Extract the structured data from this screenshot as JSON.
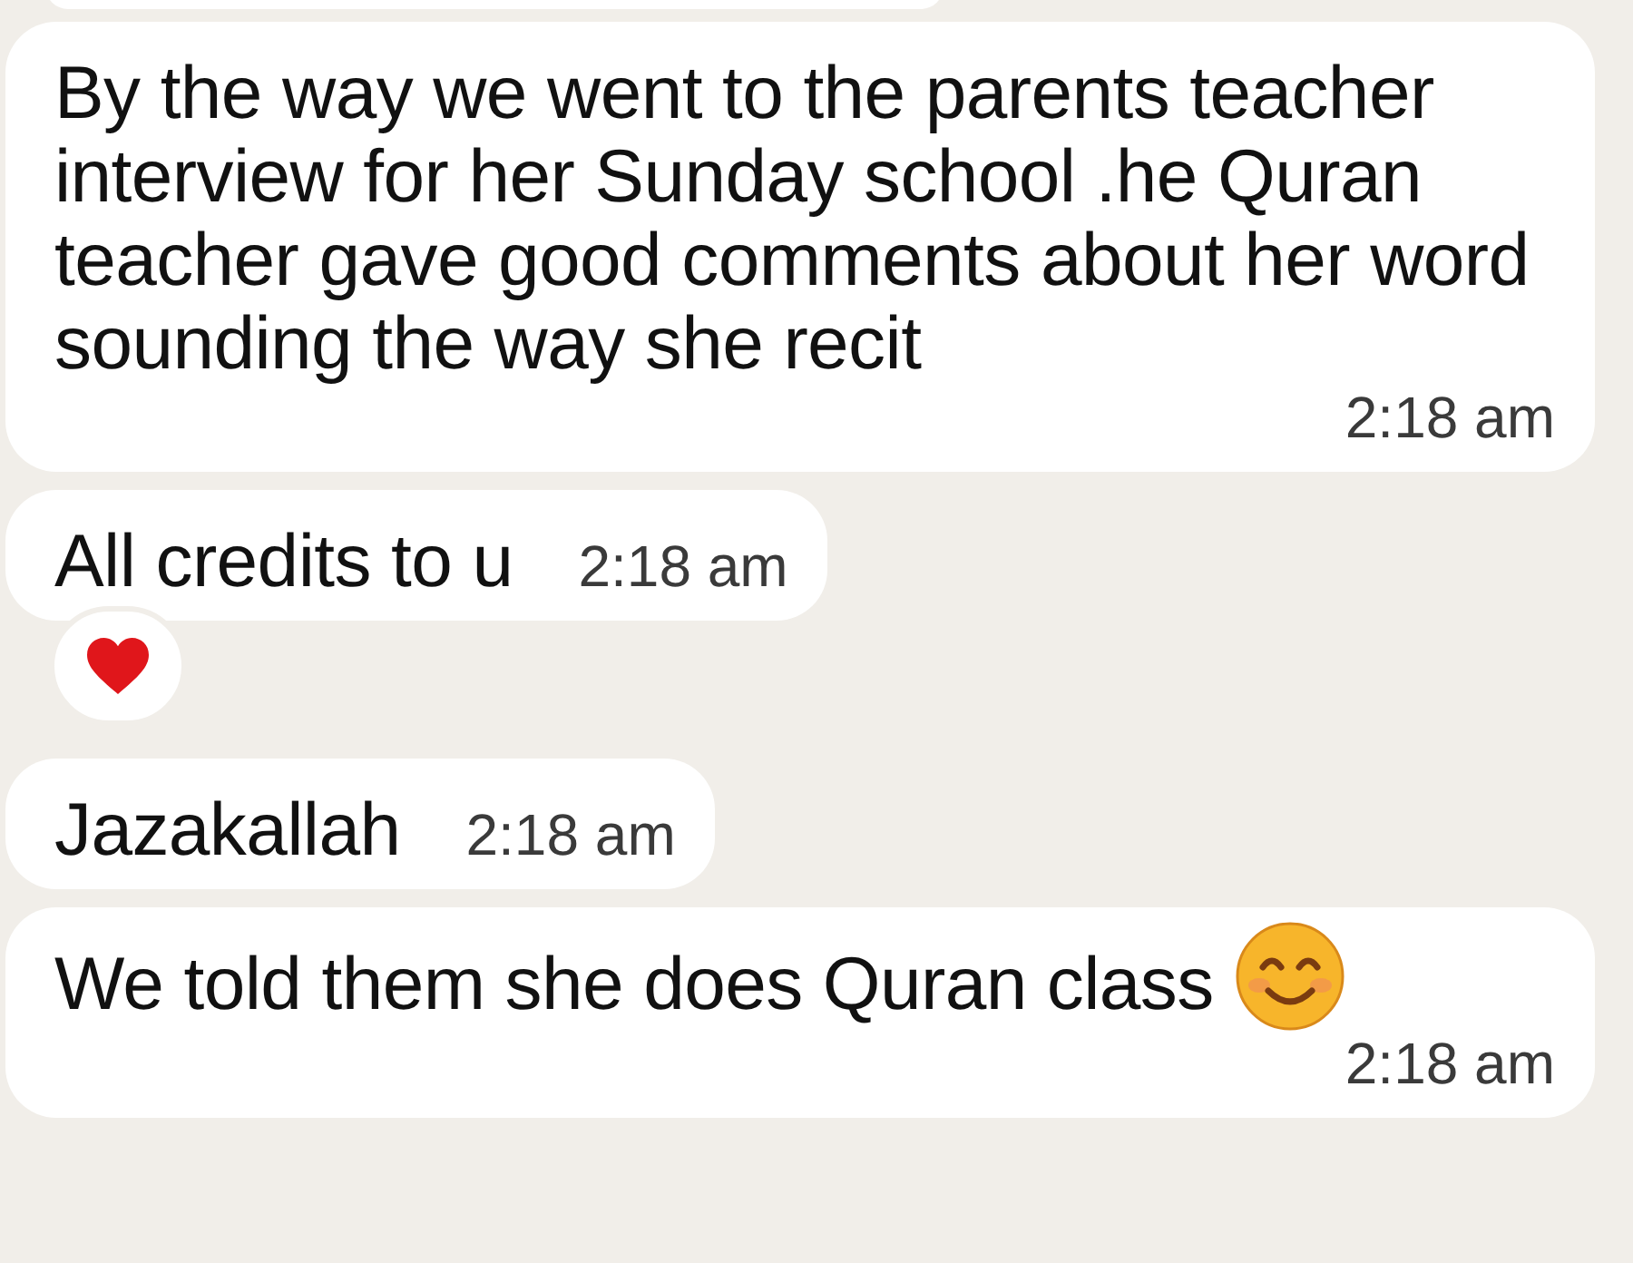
{
  "messages": [
    {
      "text": "By the way we went to the parents teacher interview for her Sunday school .he Quran teacher gave good comments about her word sounding the way she recit",
      "time": "2:18 am"
    },
    {
      "text": "All credits to u",
      "time": "2:18 am",
      "reaction": {
        "kind": "heart"
      }
    },
    {
      "text": "Jazakallah",
      "time": "2:18 am"
    },
    {
      "text": "We told them she does Quran class",
      "emoji": {
        "kind": "smiling-face"
      },
      "time": "2:18 am"
    }
  ]
}
